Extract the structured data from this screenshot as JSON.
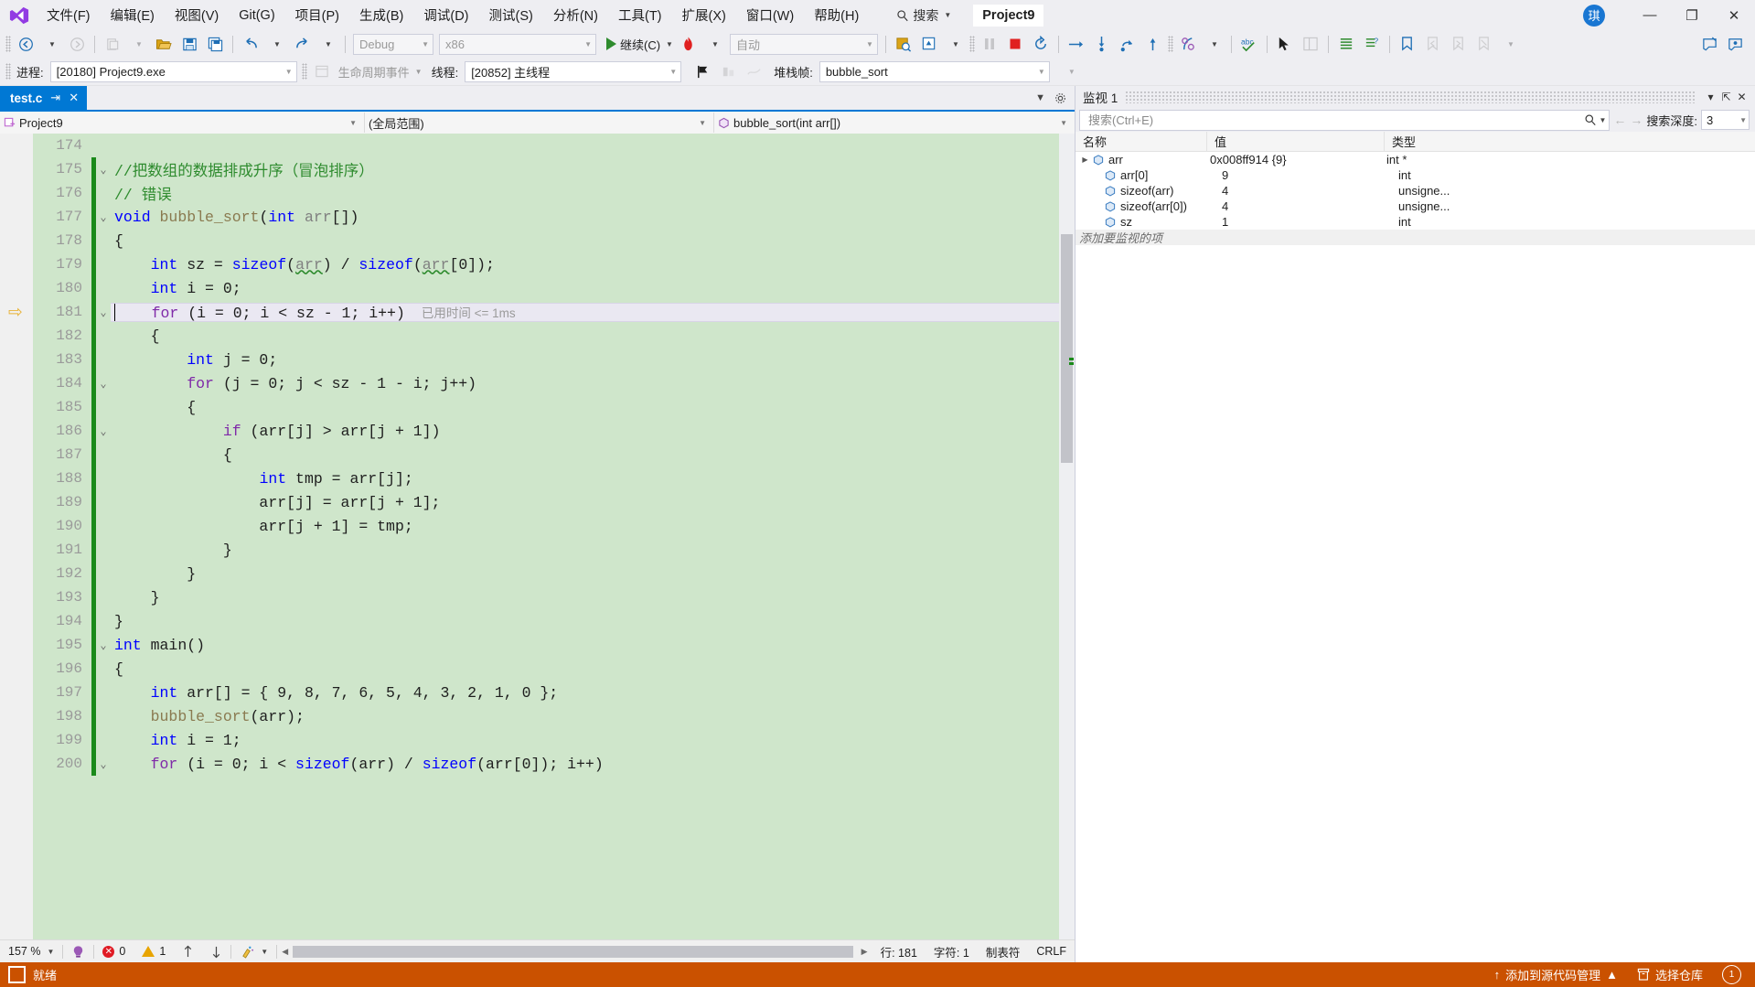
{
  "window": {
    "project_badge": "Project9",
    "account_initial": "琪",
    "minimize": "—",
    "restore": "❐",
    "close": "✕"
  },
  "menu": {
    "items": [
      {
        "label": "文件(F)"
      },
      {
        "label": "编辑(E)"
      },
      {
        "label": "视图(V)"
      },
      {
        "label": "Git(G)"
      },
      {
        "label": "项目(P)"
      },
      {
        "label": "生成(B)"
      },
      {
        "label": "调试(D)"
      },
      {
        "label": "测试(S)"
      },
      {
        "label": "分析(N)"
      },
      {
        "label": "工具(T)"
      },
      {
        "label": "扩展(X)"
      },
      {
        "label": "窗口(W)"
      },
      {
        "label": "帮助(H)"
      }
    ],
    "search_label": "搜索"
  },
  "toolbar": {
    "config": "Debug",
    "platform": "x86",
    "continue_label": "继续(C)",
    "auto_label": "自动"
  },
  "debugbar": {
    "process_label": "进程:",
    "process_value": "[20180] Project9.exe",
    "lifecycle_label": "生命周期事件",
    "thread_label": "线程:",
    "thread_value": "[20852] 主线程",
    "stackframe_label": "堆栈帧:",
    "stackframe_value": "bubble_sort"
  },
  "tabs": {
    "active": "test.c",
    "pin": "⇥",
    "close": "✕"
  },
  "navbar": {
    "project": "Project9",
    "scope": "(全局范围)",
    "member": "bubble_sort(int arr[])"
  },
  "editor": {
    "current_line": 181,
    "timing_annotation": "已用时间 <= 1ms",
    "lines": [
      {
        "n": 174,
        "tokens": [],
        "mod": false,
        "glyph": ""
      },
      {
        "n": 175,
        "tokens": [
          {
            "t": "//把数组的数据排成升序（冒泡排序）",
            "c": "cmt"
          }
        ],
        "mod": true,
        "glyph": "v",
        "indent": 0
      },
      {
        "n": 176,
        "tokens": [
          {
            "t": "// 错误",
            "c": "cmt"
          }
        ],
        "mod": true,
        "glyph": "",
        "indent": 0
      },
      {
        "n": 177,
        "tokens": [
          {
            "t": "void ",
            "c": "kw"
          },
          {
            "t": "bubble_sort",
            "c": "fn"
          },
          {
            "t": "(",
            "c": "ident"
          },
          {
            "t": "int ",
            "c": "kw"
          },
          {
            "t": "arr",
            "c": "var"
          },
          {
            "t": "[])",
            "c": "ident"
          }
        ],
        "mod": true,
        "glyph": "v",
        "indent": 0
      },
      {
        "n": 178,
        "tokens": [
          {
            "t": "{",
            "c": "ident"
          }
        ],
        "mod": true,
        "glyph": "",
        "indent": 1
      },
      {
        "n": 179,
        "tokens": [
          {
            "t": "    ",
            "c": "ident"
          },
          {
            "t": "int ",
            "c": "kw"
          },
          {
            "t": "sz = ",
            "c": "ident"
          },
          {
            "t": "sizeof",
            "c": "kw"
          },
          {
            "t": "(",
            "c": "ident"
          },
          {
            "t": "arr",
            "c": "var"
          },
          {
            "t": ") / ",
            "c": "ident"
          },
          {
            "t": "sizeof",
            "c": "kw"
          },
          {
            "t": "(",
            "c": "ident"
          },
          {
            "t": "arr",
            "c": "var"
          },
          {
            "t": "[0]);",
            "c": "ident"
          }
        ],
        "mod": true,
        "glyph": "",
        "indent": 2,
        "squiggle": true
      },
      {
        "n": 180,
        "tokens": [
          {
            "t": "    ",
            "c": "ident"
          },
          {
            "t": "int ",
            "c": "kw"
          },
          {
            "t": "i = 0;",
            "c": "ident"
          }
        ],
        "mod": true,
        "glyph": "",
        "indent": 2
      },
      {
        "n": 181,
        "tokens": [
          {
            "t": "    ",
            "c": "ident"
          },
          {
            "t": "for ",
            "c": "kw2"
          },
          {
            "t": "(i = 0; i < sz - 1; i++)",
            "c": "ident"
          }
        ],
        "mod": true,
        "glyph": "v",
        "indent": 2,
        "current": true
      },
      {
        "n": 182,
        "tokens": [
          {
            "t": "    {",
            "c": "ident"
          }
        ],
        "mod": true,
        "glyph": "",
        "indent": 2
      },
      {
        "n": 183,
        "tokens": [
          {
            "t": "        ",
            "c": "ident"
          },
          {
            "t": "int ",
            "c": "kw"
          },
          {
            "t": "j = 0;",
            "c": "ident"
          }
        ],
        "mod": true,
        "glyph": "",
        "indent": 3
      },
      {
        "n": 184,
        "tokens": [
          {
            "t": "        ",
            "c": "ident"
          },
          {
            "t": "for ",
            "c": "kw2"
          },
          {
            "t": "(j = 0; j < sz - 1 - i; j++)",
            "c": "ident"
          }
        ],
        "mod": true,
        "glyph": "v",
        "indent": 3
      },
      {
        "n": 185,
        "tokens": [
          {
            "t": "        {",
            "c": "ident"
          }
        ],
        "mod": true,
        "glyph": "",
        "indent": 3
      },
      {
        "n": 186,
        "tokens": [
          {
            "t": "            ",
            "c": "ident"
          },
          {
            "t": "if ",
            "c": "kw2"
          },
          {
            "t": "(arr[j] > arr[j + 1])",
            "c": "ident"
          }
        ],
        "mod": true,
        "glyph": "v",
        "indent": 4
      },
      {
        "n": 187,
        "tokens": [
          {
            "t": "            {",
            "c": "ident"
          }
        ],
        "mod": true,
        "glyph": "",
        "indent": 4
      },
      {
        "n": 188,
        "tokens": [
          {
            "t": "                ",
            "c": "ident"
          },
          {
            "t": "int ",
            "c": "kw"
          },
          {
            "t": "tmp = arr[j];",
            "c": "ident"
          }
        ],
        "mod": true,
        "glyph": "",
        "indent": 5
      },
      {
        "n": 189,
        "tokens": [
          {
            "t": "                arr[j] = arr[j + 1];",
            "c": "ident"
          }
        ],
        "mod": true,
        "glyph": "",
        "indent": 5
      },
      {
        "n": 190,
        "tokens": [
          {
            "t": "                arr[j + 1] = tmp;",
            "c": "ident"
          }
        ],
        "mod": true,
        "glyph": "",
        "indent": 5
      },
      {
        "n": 191,
        "tokens": [
          {
            "t": "            }",
            "c": "ident"
          }
        ],
        "mod": true,
        "glyph": "",
        "indent": 4
      },
      {
        "n": 192,
        "tokens": [
          {
            "t": "        }",
            "c": "ident"
          }
        ],
        "mod": true,
        "glyph": "",
        "indent": 3
      },
      {
        "n": 193,
        "tokens": [
          {
            "t": "    }",
            "c": "ident"
          }
        ],
        "mod": true,
        "glyph": "",
        "indent": 2
      },
      {
        "n": 194,
        "tokens": [
          {
            "t": "}",
            "c": "ident"
          }
        ],
        "mod": true,
        "glyph": "",
        "indent": 1
      },
      {
        "n": 195,
        "tokens": [
          {
            "t": "int ",
            "c": "kw"
          },
          {
            "t": "main()",
            "c": "ident"
          }
        ],
        "mod": true,
        "glyph": "v",
        "indent": 0
      },
      {
        "n": 196,
        "tokens": [
          {
            "t": "{",
            "c": "ident"
          }
        ],
        "mod": true,
        "glyph": "",
        "indent": 1
      },
      {
        "n": 197,
        "tokens": [
          {
            "t": "    ",
            "c": "ident"
          },
          {
            "t": "int ",
            "c": "kw"
          },
          {
            "t": "arr[] = { 9, 8, 7, 6, 5, 4, 3, 2, 1, 0 };",
            "c": "ident"
          }
        ],
        "mod": true,
        "glyph": "",
        "indent": 2
      },
      {
        "n": 198,
        "tokens": [
          {
            "t": "    ",
            "c": "ident"
          },
          {
            "t": "bubble_sort",
            "c": "fn"
          },
          {
            "t": "(arr);",
            "c": "ident"
          }
        ],
        "mod": true,
        "glyph": "",
        "indent": 2
      },
      {
        "n": 199,
        "tokens": [
          {
            "t": "    ",
            "c": "ident"
          },
          {
            "t": "int ",
            "c": "kw"
          },
          {
            "t": "i = 1;",
            "c": "ident"
          }
        ],
        "mod": true,
        "glyph": "",
        "indent": 2
      },
      {
        "n": 200,
        "tokens": [
          {
            "t": "    ",
            "c": "ident"
          },
          {
            "t": "for ",
            "c": "kw2"
          },
          {
            "t": "(i = 0; i < ",
            "c": "ident"
          },
          {
            "t": "sizeof",
            "c": "kw"
          },
          {
            "t": "(arr) / ",
            "c": "ident"
          },
          {
            "t": "sizeof",
            "c": "kw"
          },
          {
            "t": "(arr[0]); i++)",
            "c": "ident"
          }
        ],
        "mod": true,
        "glyph": "v",
        "indent": 2
      }
    ]
  },
  "editor_status": {
    "zoom": "157 %",
    "errors": "0",
    "warnings": "1",
    "line_label": "行: 181",
    "char_label": "字符: 1",
    "tab_label": "制表符",
    "eol_label": "CRLF"
  },
  "watch": {
    "title": "监视 1",
    "dropdown": "▾",
    "pin": "⇱",
    "close": "✕",
    "search_placeholder": "搜索(Ctrl+E)",
    "prev": "←",
    "next": "→",
    "depth_label": "搜索深度:",
    "depth_value": "3",
    "columns": [
      "名称",
      "值",
      "类型"
    ],
    "rows": [
      {
        "name": "arr",
        "value": "0x008ff914 {9}",
        "type": "int *",
        "expandable": true,
        "indent": 0
      },
      {
        "name": "arr[0]",
        "value": "9",
        "type": "int",
        "expandable": false,
        "indent": 1
      },
      {
        "name": "sizeof(arr)",
        "value": "4",
        "type": "unsigne...",
        "expandable": false,
        "indent": 1
      },
      {
        "name": "sizeof(arr[0])",
        "value": "4",
        "type": "unsigne...",
        "expandable": false,
        "indent": 1
      },
      {
        "name": "sz",
        "value": "1",
        "type": "int",
        "expandable": false,
        "indent": 1
      }
    ],
    "add_row": "添加要监视的项"
  },
  "statusbar": {
    "state": "就绪",
    "source_control": "添加到源代码管理",
    "source_caret": "▲",
    "repo": "选择仓库",
    "notifications": "1",
    "accent": "#ca5100"
  },
  "colors": {
    "tab_active": "#0078d4",
    "editor_bg": "#cfe6cb",
    "modified_bar": "#1a8a1a",
    "keyword": "#0000ff",
    "control_keyword": "#7f29a8",
    "comment": "#2e8b2e",
    "current_line": "#eae8f2"
  }
}
